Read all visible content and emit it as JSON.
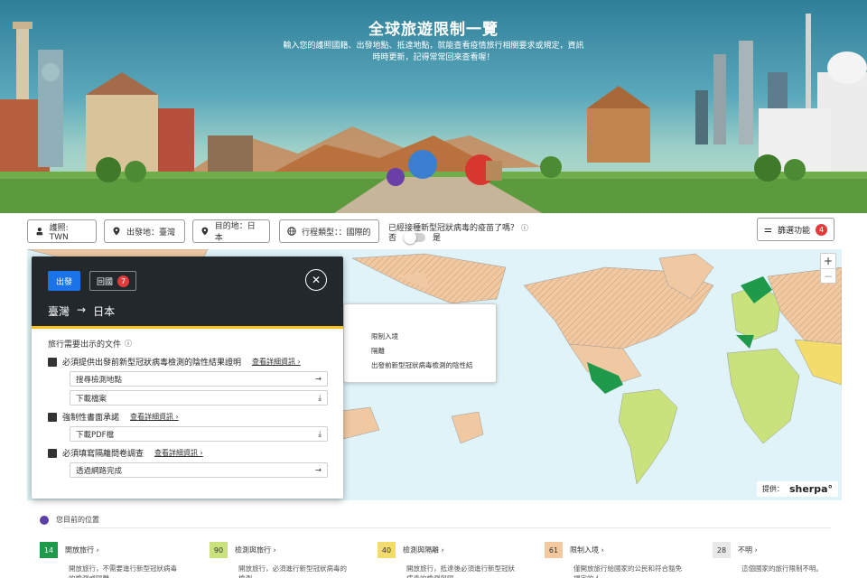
{
  "hero": {
    "title": "全球旅遊限制一覽",
    "subtitle_line1": "輸入您的護照國籍、出發地點、抵達地點，就能查看疫情旅行相關要求或規定，資訊",
    "subtitle_line2": "時時更新，記得常常回來查看喔！"
  },
  "filters": {
    "passport": "護照: TWN",
    "origin": "出發地：臺灣",
    "destination": "目的地：日本",
    "trip_type": "行程類型：：國際的",
    "vaccinated_question": "已經接種新型冠狀病毒的疫苗了嗎？",
    "no": "否",
    "yes": "是",
    "feature_button": "篩選功能",
    "feature_count": "4"
  },
  "panel": {
    "tab_outbound": "出發",
    "tab_return": "回國",
    "return_count": "7",
    "route_from": "臺灣",
    "route_arrow": "→",
    "route_to": "日本",
    "section_title": "旅行需要出示的文件",
    "requirements": [
      {
        "label": "必須提供出發前新型冠狀病毒檢測的陰性結果證明",
        "detail": "查看詳細資訊 ›",
        "actions": [
          {
            "label": "搜尋檢測地點",
            "icon": "→"
          },
          {
            "label": "下載檔案",
            "icon": "⤓"
          }
        ]
      },
      {
        "label": "強制性書面承諾",
        "detail": "查看詳細資訊 ›",
        "actions": [
          {
            "label": "下載PDF檔",
            "icon": "⤓"
          }
        ]
      },
      {
        "label": "必須填寫隔離問卷調查",
        "detail": "查看詳細資訊 ›",
        "actions": [
          {
            "label": "透過網路完成",
            "icon": "→"
          }
        ]
      }
    ]
  },
  "map_popup": {
    "line1": "限制入境",
    "line2": "隔離",
    "line3": "出發前新型冠狀病毒檢測的陰性結"
  },
  "map": {
    "zoom_in": "+",
    "zoom_out": "−",
    "credit_prefix": "提供：",
    "credit_brand": "sherpa°"
  },
  "location_label": "您目前的位置",
  "legend": [
    {
      "count": "14",
      "title": "開放旅行 ›",
      "desc": "開放旅行，不需要進行新型冠狀病毒的檢測或隔離",
      "color": "#1f9a4a",
      "text_color": "#ffffff"
    },
    {
      "count": "90",
      "title": "檢測與旅行 ›",
      "desc": "開放旅行，必須進行新型冠狀病毒的檢測",
      "color": "#c9e27c",
      "text_color": "#333333"
    },
    {
      "count": "40",
      "title": "檢測與隔離 ›",
      "desc": "開放旅行，抵達後必須進行新型冠狀病毒的檢測與隔",
      "color": "#f3dc6b",
      "text_color": "#333333"
    },
    {
      "count": "61",
      "title": "限制入境 ›",
      "desc": "僅開放旅行給國家的公民和符合豁免規定的人。",
      "color": "#f3caa0",
      "text_color": "#333333"
    },
    {
      "count": "28",
      "title": "不明 ›",
      "desc": "這個國家的旅行限制不明。",
      "color": "#e8e8e8",
      "text_color": "#333333"
    }
  ]
}
